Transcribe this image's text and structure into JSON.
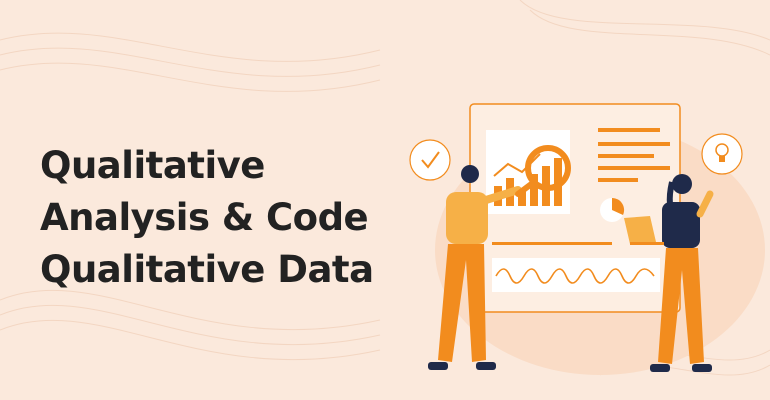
{
  "headline": {
    "line1": "Qualitative",
    "line2": "Analysis & Code",
    "line3": "Qualitative Data"
  },
  "icons": [
    "checkmark-bubble-icon",
    "lightbulb-bubble-icon",
    "magnifier-icon",
    "pie-chart-icon",
    "laptop-icon"
  ],
  "colors": {
    "background": "#fbe9dc",
    "accent": "#f28c1e",
    "text": "#222222",
    "navy": "#1f2a4a"
  }
}
